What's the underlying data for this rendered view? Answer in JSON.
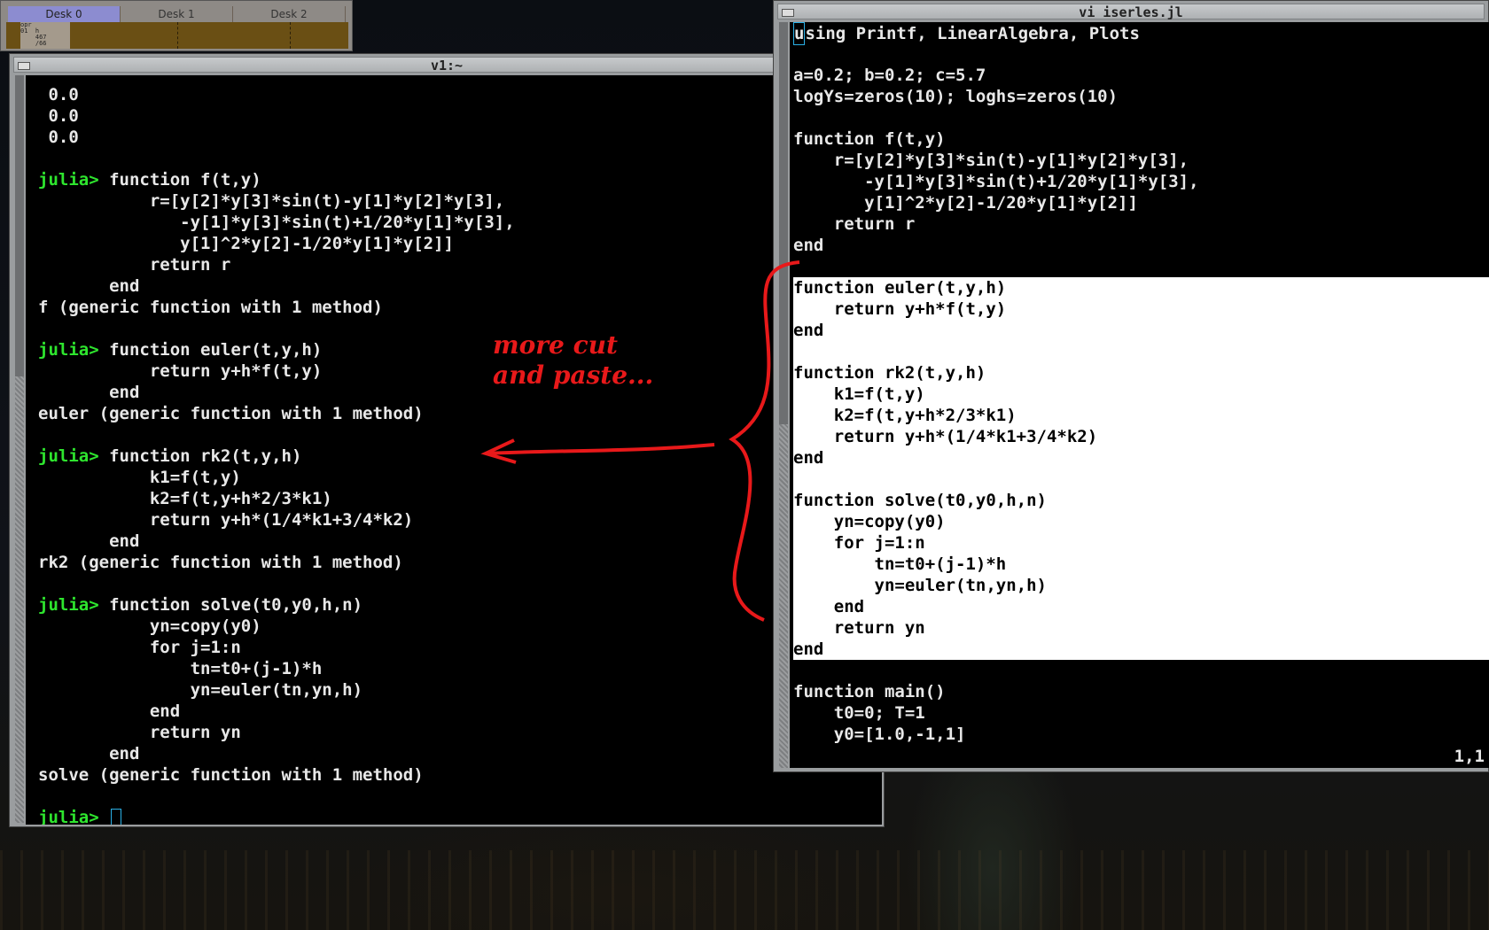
{
  "pager": {
    "desks": [
      "Desk 0",
      "Desk 1",
      "Desk 2"
    ],
    "mini_text": "opr\n01  h\n    467\n    /66"
  },
  "repl_window": {
    "title": "v1:~",
    "lines": [
      {
        "prompt": "",
        "text": " 0.0"
      },
      {
        "prompt": "",
        "text": " 0.0"
      },
      {
        "prompt": "",
        "text": " 0.0"
      },
      {
        "prompt": "",
        "text": ""
      },
      {
        "prompt": "julia> ",
        "text": "function f(t,y)"
      },
      {
        "prompt": "",
        "text": "           r=[y[2]*y[3]*sin(t)-y[1]*y[2]*y[3],"
      },
      {
        "prompt": "",
        "text": "              -y[1]*y[3]*sin(t)+1/20*y[1]*y[3],"
      },
      {
        "prompt": "",
        "text": "              y[1]^2*y[2]-1/20*y[1]*y[2]]"
      },
      {
        "prompt": "",
        "text": "           return r"
      },
      {
        "prompt": "",
        "text": "       end"
      },
      {
        "prompt": "",
        "text": "f (generic function with 1 method)"
      },
      {
        "prompt": "",
        "text": ""
      },
      {
        "prompt": "julia> ",
        "text": "function euler(t,y,h)"
      },
      {
        "prompt": "",
        "text": "           return y+h*f(t,y)"
      },
      {
        "prompt": "",
        "text": "       end"
      },
      {
        "prompt": "",
        "text": "euler (generic function with 1 method)"
      },
      {
        "prompt": "",
        "text": ""
      },
      {
        "prompt": "julia> ",
        "text": "function rk2(t,y,h)"
      },
      {
        "prompt": "",
        "text": "           k1=f(t,y)"
      },
      {
        "prompt": "",
        "text": "           k2=f(t,y+h*2/3*k1)"
      },
      {
        "prompt": "",
        "text": "           return y+h*(1/4*k1+3/4*k2)"
      },
      {
        "prompt": "",
        "text": "       end"
      },
      {
        "prompt": "",
        "text": "rk2 (generic function with 1 method)"
      },
      {
        "prompt": "",
        "text": ""
      },
      {
        "prompt": "julia> ",
        "text": "function solve(t0,y0,h,n)"
      },
      {
        "prompt": "",
        "text": "           yn=copy(y0)"
      },
      {
        "prompt": "",
        "text": "           for j=1:n"
      },
      {
        "prompt": "",
        "text": "               tn=t0+(j-1)*h"
      },
      {
        "prompt": "",
        "text": "               yn=euler(tn,yn,h)"
      },
      {
        "prompt": "",
        "text": "           end"
      },
      {
        "prompt": "",
        "text": "           return yn"
      },
      {
        "prompt": "",
        "text": "       end"
      },
      {
        "prompt": "",
        "text": "solve (generic function with 1 method)"
      },
      {
        "prompt": "",
        "text": ""
      },
      {
        "prompt": "julia> ",
        "text": ""
      }
    ]
  },
  "vi_window": {
    "title": "vi iserles.jl",
    "status": "1,1",
    "lines": [
      {
        "text": "using Printf, LinearAlgebra, Plots",
        "selected": false
      },
      {
        "text": "",
        "selected": false
      },
      {
        "text": "a=0.2; b=0.2; c=5.7",
        "selected": false
      },
      {
        "text": "logYs=zeros(10); loghs=zeros(10)",
        "selected": false
      },
      {
        "text": "",
        "selected": false
      },
      {
        "text": "function f(t,y)",
        "selected": false
      },
      {
        "text": "    r=[y[2]*y[3]*sin(t)-y[1]*y[2]*y[3],",
        "selected": false
      },
      {
        "text": "       -y[1]*y[3]*sin(t)+1/20*y[1]*y[3],",
        "selected": false
      },
      {
        "text": "       y[1]^2*y[2]-1/20*y[1]*y[2]]",
        "selected": false
      },
      {
        "text": "    return r",
        "selected": false
      },
      {
        "text": "end",
        "selected": false
      },
      {
        "text": "",
        "selected": false
      },
      {
        "text": "function euler(t,y,h)",
        "selected": true
      },
      {
        "text": "    return y+h*f(t,y)",
        "selected": true
      },
      {
        "text": "end",
        "selected": true
      },
      {
        "text": "",
        "selected": true
      },
      {
        "text": "function rk2(t,y,h)",
        "selected": true
      },
      {
        "text": "    k1=f(t,y)",
        "selected": true
      },
      {
        "text": "    k2=f(t,y+h*2/3*k1)",
        "selected": true
      },
      {
        "text": "    return y+h*(1/4*k1+3/4*k2)",
        "selected": true
      },
      {
        "text": "end",
        "selected": true
      },
      {
        "text": "",
        "selected": true
      },
      {
        "text": "function solve(t0,y0,h,n)",
        "selected": true
      },
      {
        "text": "    yn=copy(y0)",
        "selected": true
      },
      {
        "text": "    for j=1:n",
        "selected": true
      },
      {
        "text": "        tn=t0+(j-1)*h",
        "selected": true
      },
      {
        "text": "        yn=euler(tn,yn,h)",
        "selected": true
      },
      {
        "text": "    end",
        "selected": true
      },
      {
        "text": "    return yn",
        "selected": true
      },
      {
        "text": "end",
        "selected": true
      },
      {
        "text": "",
        "selected": false
      },
      {
        "text": "function main()",
        "selected": false
      },
      {
        "text": "    t0=0; T=1",
        "selected": false
      },
      {
        "text": "    y0=[1.0,-1,1]",
        "selected": false
      }
    ]
  },
  "annotation": {
    "line1": "more cut",
    "line2": "and paste...",
    "color": "#e8191a"
  },
  "colors": {
    "prompt": "#2ee52e",
    "terminal_bg": "#000000",
    "selection_bg": "#ffffff",
    "cursor": "#2ab0e6"
  }
}
